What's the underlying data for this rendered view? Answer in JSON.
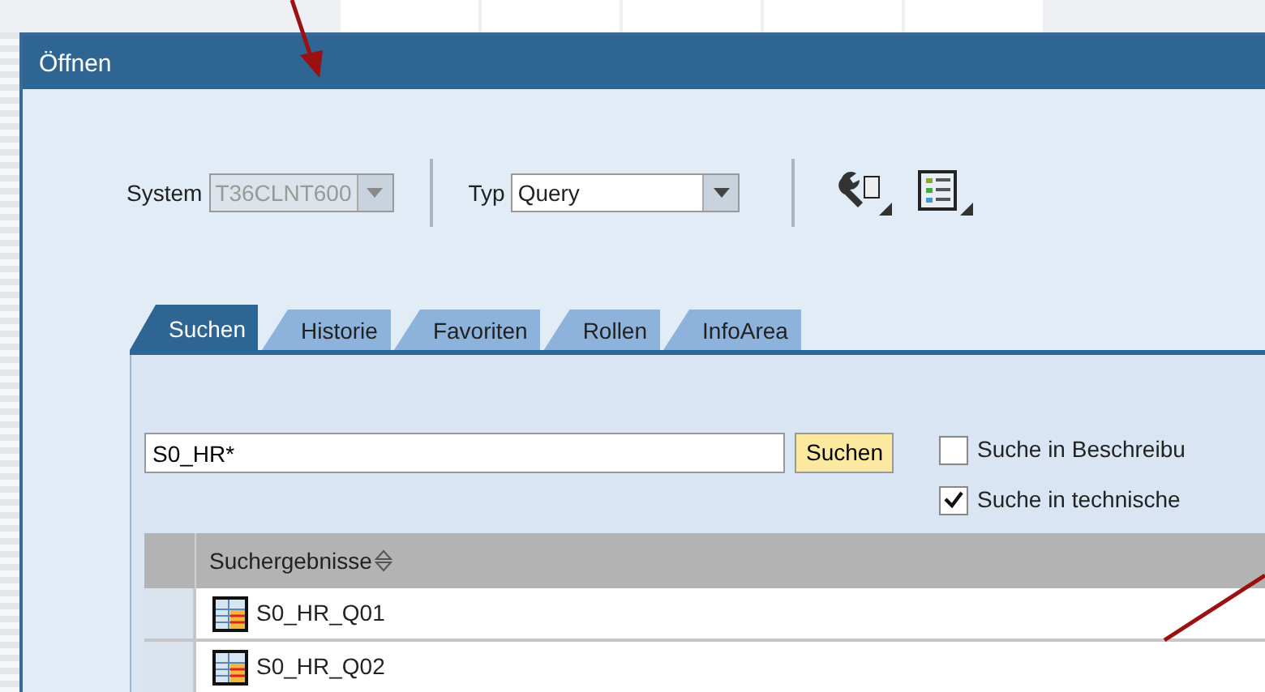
{
  "window": {
    "title": "Öffnen"
  },
  "system": {
    "label": "System",
    "value": "T36CLNT600",
    "disabled": true
  },
  "type": {
    "label": "Typ",
    "value": "Query"
  },
  "tabs": [
    {
      "label": "Suchen",
      "selected": true
    },
    {
      "label": "Historie",
      "selected": false
    },
    {
      "label": "Favoriten",
      "selected": false
    },
    {
      "label": "Rollen",
      "selected": false
    },
    {
      "label": "InfoArea",
      "selected": false
    }
  ],
  "search": {
    "value": "S0_HR*",
    "button": "Suchen"
  },
  "options": [
    {
      "label": "Suche in Beschreibu",
      "checked": false
    },
    {
      "label": "Suche in technische",
      "checked": true
    }
  ],
  "results": {
    "column": "Suchergebnisse",
    "rows": [
      {
        "name": "S0_HR_Q01"
      },
      {
        "name": "S0_HR_Q02"
      }
    ]
  }
}
